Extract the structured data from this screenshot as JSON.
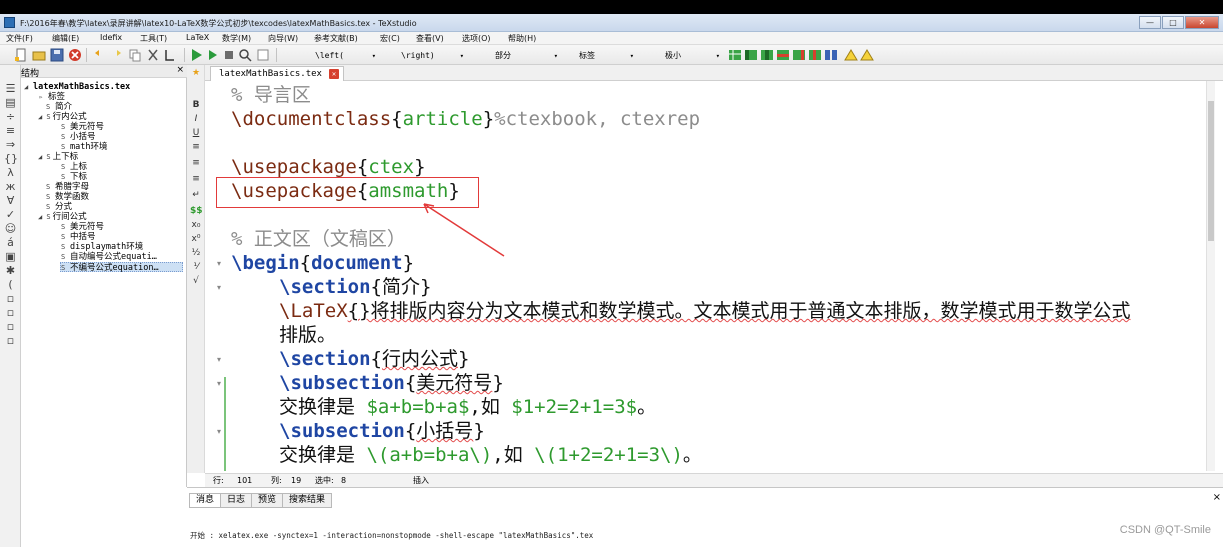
{
  "window": {
    "title": "F:\\2016年春\\教学\\latex\\录屏讲解\\latex10-LaTeX数学公式初步\\texcodes\\latexMathBasics.tex - TeXstudio",
    "minimize": "—",
    "maximize": "□",
    "close": "✕"
  },
  "menu": [
    "文件(F)",
    "编辑(E)",
    "Idefix",
    "工具(T)",
    "LaTeX",
    "数学(M)",
    "向导(W)",
    "参考文献(B)",
    "宏(C)",
    "查看(V)",
    "选项(O)",
    "帮助(H)"
  ],
  "toolbar": {
    "combo_left": "\\left(",
    "combo_right": "\\right)",
    "combo_part": "部分",
    "combo_label": "标签",
    "combo_size": "极小"
  },
  "structure": {
    "header": "结构",
    "close": "×",
    "items": [
      {
        "text": "latexMathBasics.tex",
        "level": 0,
        "glyph": "◢"
      },
      {
        "text": "标签",
        "level": 1,
        "glyph": "▹"
      },
      {
        "text": "简介",
        "level": 1,
        "glyph": "S"
      },
      {
        "text": "行内公式",
        "level": 1,
        "glyph": "◢ S"
      },
      {
        "text": "美元符号",
        "level": 2,
        "glyph": "S"
      },
      {
        "text": "小括号",
        "level": 2,
        "glyph": "S"
      },
      {
        "text": "math环境",
        "level": 2,
        "glyph": "S"
      },
      {
        "text": "上下标",
        "level": 1,
        "glyph": "◢ S"
      },
      {
        "text": "上标",
        "level": 2,
        "glyph": "S"
      },
      {
        "text": "下标",
        "level": 2,
        "glyph": "S"
      },
      {
        "text": "希腊字母",
        "level": 1,
        "glyph": "S"
      },
      {
        "text": "数学函数",
        "level": 1,
        "glyph": "S"
      },
      {
        "text": "分式",
        "level": 1,
        "glyph": "S"
      },
      {
        "text": "行间公式",
        "level": 1,
        "glyph": "◢ S"
      },
      {
        "text": "美元符号",
        "level": 2,
        "glyph": "S"
      },
      {
        "text": "中括号",
        "level": 2,
        "glyph": "S"
      },
      {
        "text": "displaymath环境",
        "level": 2,
        "glyph": "S"
      },
      {
        "text": "自动编号公式equati…",
        "level": 2,
        "glyph": "S"
      },
      {
        "text": "不编号公式equation…",
        "level": 2,
        "glyph": "S"
      }
    ]
  },
  "tab": {
    "label": "latexMathBasics.tex",
    "close": "✕"
  },
  "editor": {
    "l1": "% 导言区",
    "l2_cmd": "\\documentclass",
    "l2_arg": "article",
    "l2_rest": "%ctexbook, ctexrep",
    "l3_cmd": "\\usepackage",
    "l3_arg": "ctex",
    "l4_cmd": "\\usepackage",
    "l4_arg": "amsmath",
    "l5": "% 正文区（文稿区）",
    "l6_cmd": "\\begin",
    "l6_arg": "document",
    "l7_cmd": "\\section",
    "l7_arg": "简介",
    "l8_cmd": "\\LaTeX",
    "l8_text": "{}将排版内容分为文本模式和数学模式。文本模式用于普通文本排版，数学模式用于数学公式",
    "l9": "排版。",
    "l10_cmd": "\\section",
    "l10_arg": "行内公式",
    "l11_cmd": "\\subsection",
    "l11_arg": "美元符号",
    "l12_a": "交换律是 ",
    "l12_m1": "$a+b=b+a$",
    "l12_b": ",如 ",
    "l12_m2": "$1+2=2+1=3$",
    "l12_c": "。",
    "l13_cmd": "\\subsection",
    "l13_arg": "小括号",
    "l14_a": "交换律是 ",
    "l14_m1": "\\(a+b=b+a\\)",
    "l14_b": ",如 ",
    "l14_m2": "\\(1+2=2+1=3\\)",
    "l14_c": "。"
  },
  "status": {
    "row_label": "行:",
    "row": "101",
    "col_label": "列:",
    "col": "19",
    "sel_label": "选中:",
    "sel": "8",
    "mode": "插入"
  },
  "messages": {
    "tabs": [
      "消息",
      "日志",
      "预览",
      "搜索结果"
    ],
    "close": "×",
    "log": "开始 : xelatex.exe -synctex=1 -interaction=nonstopmode -shell-escape \"latexMathBasics\".tex",
    "watermark": "CSDN @QT-Smile"
  }
}
